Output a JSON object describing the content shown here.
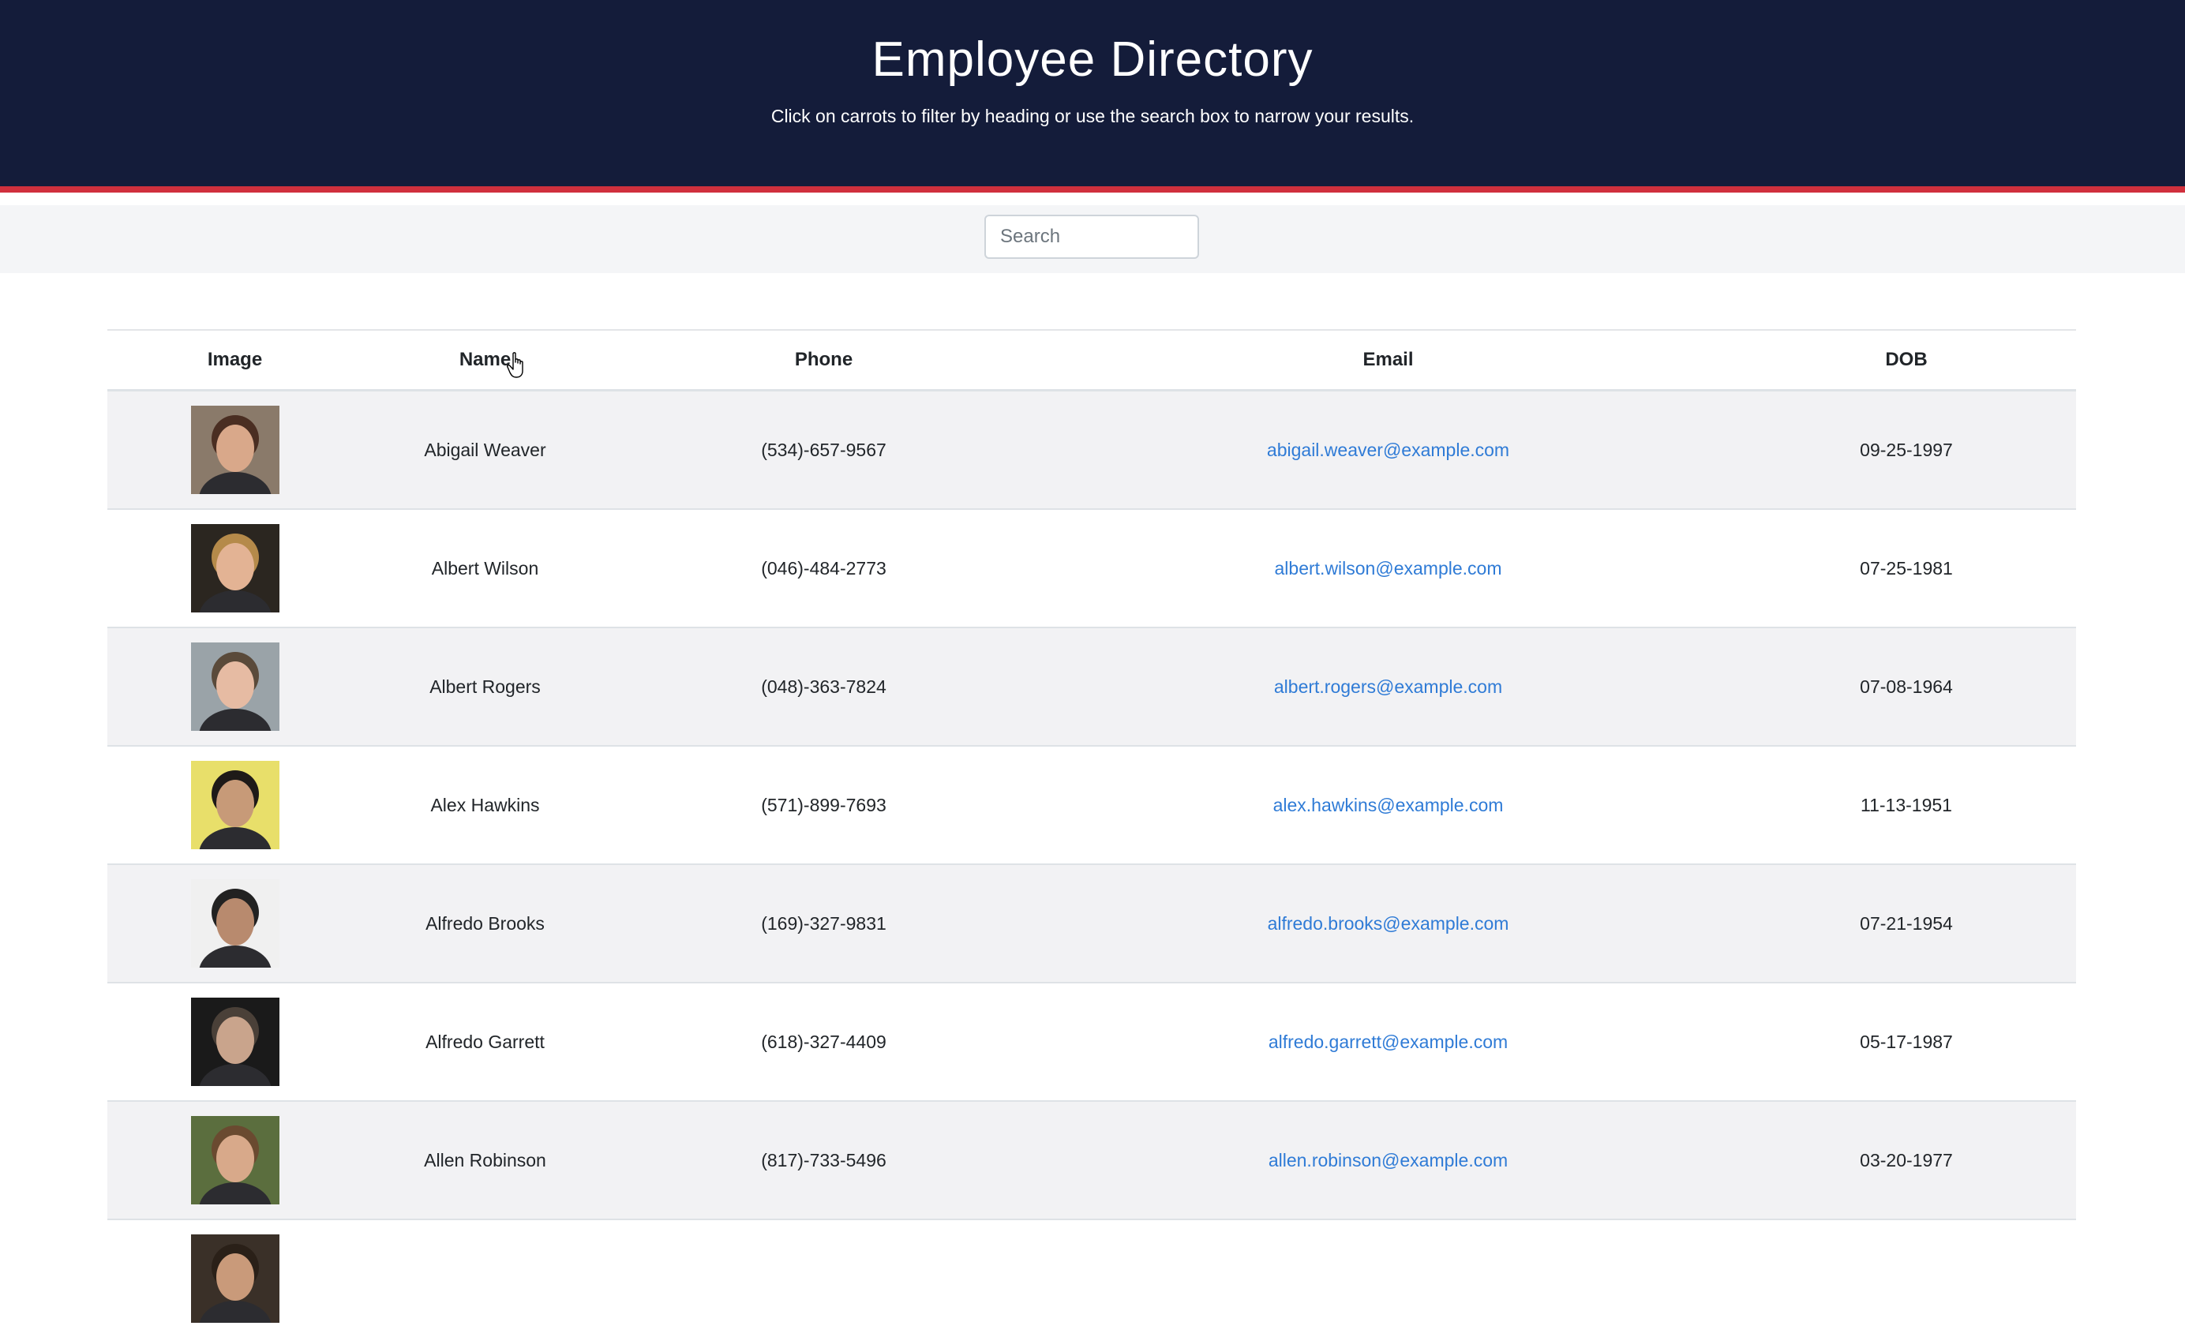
{
  "header": {
    "title": "Employee Directory",
    "subtitle": "Click on carrots to filter by heading or use the search box to narrow your results."
  },
  "search": {
    "placeholder": "Search",
    "value": ""
  },
  "table": {
    "columns": [
      "Image",
      "Name",
      "Phone",
      "Email",
      "DOB"
    ],
    "rows": [
      {
        "name": "Abigail Weaver",
        "phone": "(534)-657-9567",
        "email": "abigail.weaver@example.com",
        "dob": "09-25-1997",
        "avatar_bg": "#8a7a6a",
        "skin": "#d9a88a",
        "hair": "#4a2e22"
      },
      {
        "name": "Albert Wilson",
        "phone": "(046)-484-2773",
        "email": "albert.wilson@example.com",
        "dob": "07-25-1981",
        "avatar_bg": "#2b2620",
        "skin": "#e3b394",
        "hair": "#b58a4a"
      },
      {
        "name": "Albert Rogers",
        "phone": "(048)-363-7824",
        "email": "albert.rogers@example.com",
        "dob": "07-08-1964",
        "avatar_bg": "#9aa3a8",
        "skin": "#e6bba3",
        "hair": "#5a4a3a"
      },
      {
        "name": "Alex Hawkins",
        "phone": "(571)-899-7693",
        "email": "alex.hawkins@example.com",
        "dob": "11-13-1951",
        "avatar_bg": "#e8df6a",
        "skin": "#c79a78",
        "hair": "#1e1a18"
      },
      {
        "name": "Alfredo Brooks",
        "phone": "(169)-327-9831",
        "email": "alfredo.brooks@example.com",
        "dob": "07-21-1954",
        "avatar_bg": "#f0f0f0",
        "skin": "#b88a6e",
        "hair": "#222222"
      },
      {
        "name": "Alfredo Garrett",
        "phone": "(618)-327-4409",
        "email": "alfredo.garrett@example.com",
        "dob": "05-17-1987",
        "avatar_bg": "#1a1a1a",
        "skin": "#c9a48c",
        "hair": "#4a4038"
      },
      {
        "name": "Allen Robinson",
        "phone": "(817)-733-5496",
        "email": "allen.robinson@example.com",
        "dob": "03-20-1977",
        "avatar_bg": "#5b6e3e",
        "skin": "#d8a98a",
        "hair": "#6a4a30"
      },
      {
        "name": "",
        "phone": "",
        "email": "",
        "dob": "",
        "avatar_bg": "#3a3028",
        "skin": "#c99a7a",
        "hair": "#2a2018"
      }
    ]
  }
}
